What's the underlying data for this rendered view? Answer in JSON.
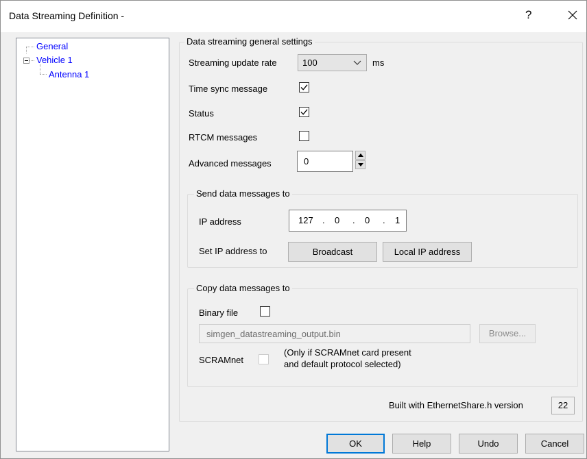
{
  "window": {
    "title": "Data Streaming Definition -",
    "help_glyph": "?",
    "close_icon": "close-icon"
  },
  "tree": {
    "items": [
      {
        "label": "General",
        "expander": "",
        "selected": true
      },
      {
        "label": "Vehicle 1",
        "expander": "minus",
        "selected": false
      },
      {
        "label": "Antenna 1",
        "expander": "",
        "selected": false
      }
    ]
  },
  "general": {
    "legend": "Data streaming general settings",
    "update_rate_label": "Streaming update rate",
    "update_rate_value": "100",
    "update_rate_unit": "ms",
    "time_sync_label": "Time sync message",
    "time_sync_checked": true,
    "status_label": "Status",
    "status_checked": true,
    "rtcm_label": "RTCM messages",
    "rtcm_checked": false,
    "advanced_label": "Advanced messages",
    "advanced_value": "0"
  },
  "send": {
    "legend": "Send data messages to",
    "ip_label": "IP address",
    "ip_parts": [
      "127",
      "0",
      "0",
      "1"
    ],
    "set_ip_label": "Set IP address to",
    "broadcast_button": "Broadcast",
    "local_ip_button": "Local IP address"
  },
  "copy": {
    "legend": "Copy data messages to",
    "binary_label": "Binary file",
    "binary_checked": false,
    "file_name": "simgen_datastreaming_output.bin",
    "browse_button": "Browse...",
    "scramnet_label": "SCRAMnet",
    "scramnet_checked": false,
    "scramnet_note_line1": "(Only if SCRAMnet card present",
    "scramnet_note_line2": "and default protocol selected)"
  },
  "footer": {
    "built_with_label": "Built with EthernetShare.h version",
    "version": "22",
    "ok_button": "OK",
    "help_button": "Help",
    "undo_button": "Undo",
    "cancel_button": "Cancel"
  },
  "colors": {
    "dialog_bg": "#f0f0f0",
    "tree_link": "#0000ff",
    "default_button_border": "#0078d7"
  }
}
